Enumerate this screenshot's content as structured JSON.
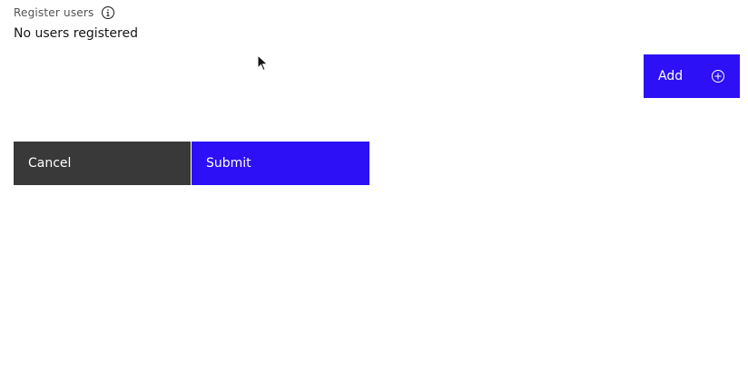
{
  "form": {
    "field_label": "Register users",
    "empty_message": "No users registered",
    "add_label": "Add",
    "cancel_label": "Cancel",
    "submit_label": "Submit"
  },
  "icons": {
    "info": "information-circle-icon",
    "add": "add-circle-icon",
    "cursor": "mouse-pointer-icon"
  },
  "colors": {
    "primary": "#2d10f6",
    "secondary": "#393939",
    "label": "#525252",
    "text": "#161616",
    "background": "#ffffff"
  }
}
